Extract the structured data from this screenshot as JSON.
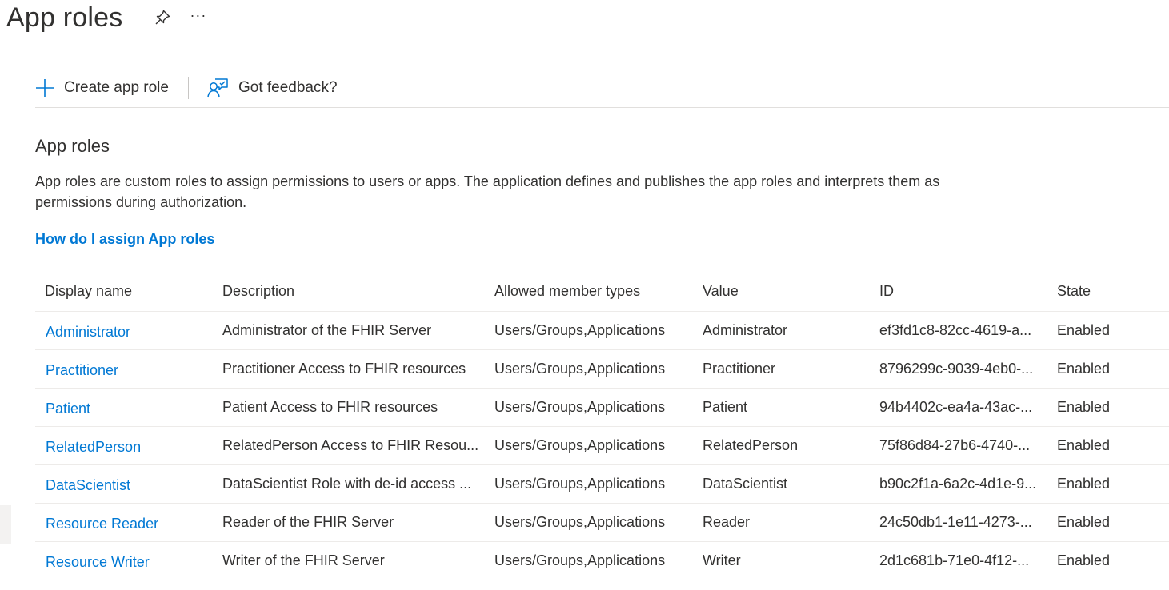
{
  "header": {
    "title": "App roles",
    "more_label": "···"
  },
  "commands": {
    "create_label": "Create app role",
    "feedback_label": "Got feedback?"
  },
  "section": {
    "heading": "App roles",
    "description": "App roles are custom roles to assign permissions to users or apps. The application defines and publishes the app roles and interprets them as permissions during authorization.",
    "help_link": "How do I assign App roles"
  },
  "table": {
    "columns": [
      "Display name",
      "Description",
      "Allowed member types",
      "Value",
      "ID",
      "State"
    ],
    "rows": [
      {
        "name": "Administrator",
        "description": "Administrator of the FHIR Server",
        "member_types": "Users/Groups,Applications",
        "value": "Administrator",
        "id": "ef3fd1c8-82cc-4619-a...",
        "state": "Enabled"
      },
      {
        "name": "Practitioner",
        "description": "Practitioner Access to FHIR resources",
        "member_types": "Users/Groups,Applications",
        "value": "Practitioner",
        "id": "8796299c-9039-4eb0-...",
        "state": "Enabled"
      },
      {
        "name": "Patient",
        "description": "Patient Access to FHIR resources",
        "member_types": "Users/Groups,Applications",
        "value": "Patient",
        "id": "94b4402c-ea4a-43ac-...",
        "state": "Enabled"
      },
      {
        "name": "RelatedPerson",
        "description": "RelatedPerson Access to FHIR Resou...",
        "member_types": "Users/Groups,Applications",
        "value": "RelatedPerson",
        "id": "75f86d84-27b6-4740-...",
        "state": "Enabled"
      },
      {
        "name": "DataScientist",
        "description": "DataScientist Role with de-id access ...",
        "member_types": "Users/Groups,Applications",
        "value": "DataScientist",
        "id": "b90c2f1a-6a2c-4d1e-9...",
        "state": "Enabled"
      },
      {
        "name": "Resource Reader",
        "description": "Reader of the FHIR Server",
        "member_types": "Users/Groups,Applications",
        "value": "Reader",
        "id": "24c50db1-1e11-4273-...",
        "state": "Enabled"
      },
      {
        "name": "Resource Writer",
        "description": "Writer of the FHIR Server",
        "member_types": "Users/Groups,Applications",
        "value": "Writer",
        "id": "2d1c681b-71e0-4f12-...",
        "state": "Enabled"
      }
    ]
  },
  "colors": {
    "accent": "#0078d4",
    "text": "#323130",
    "divider": "#edebe9"
  },
  "icons": {
    "pin": "pin-icon",
    "more": "more-icon",
    "add": "add-icon",
    "feedback": "feedback-icon"
  }
}
